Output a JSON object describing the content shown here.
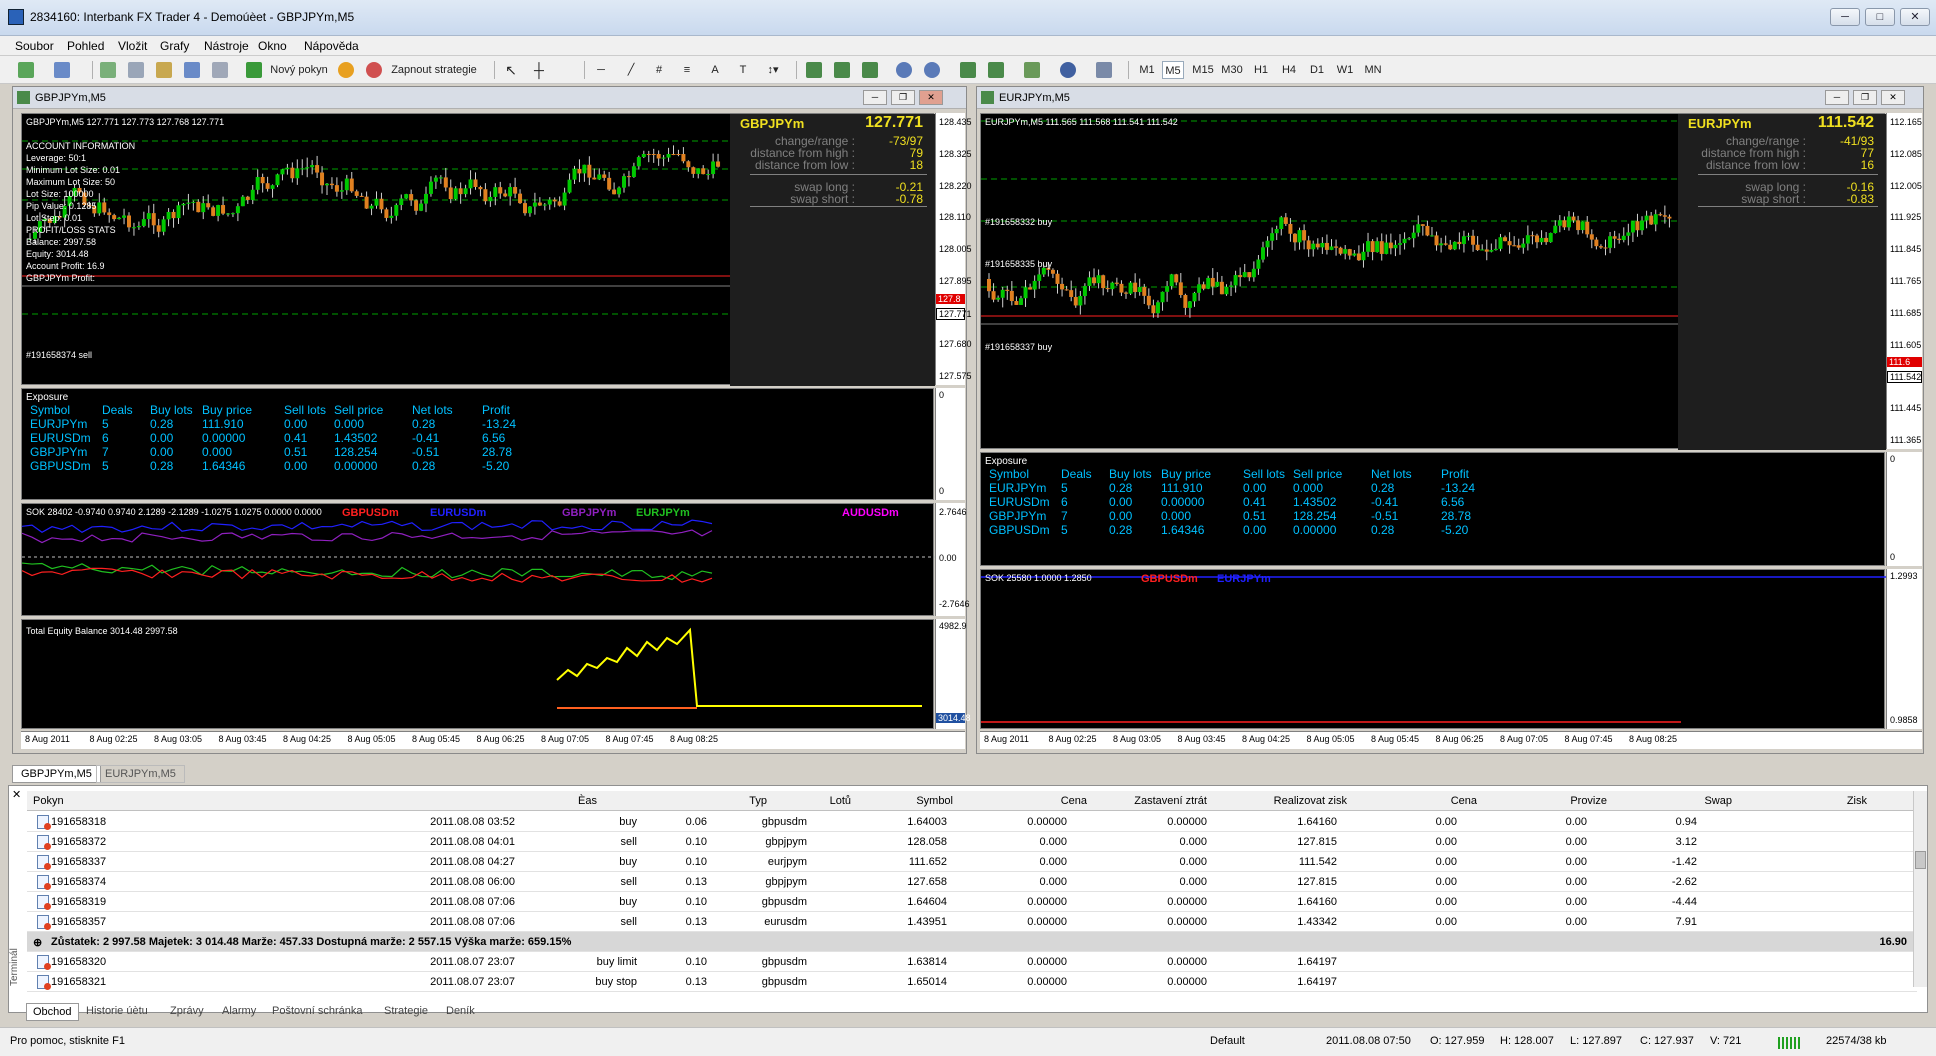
{
  "window": {
    "title": "2834160: Interbank FX Trader 4 - Demoúèet - GBPJPYm,M5"
  },
  "menu": [
    "Soubor",
    "Pohled",
    "Vložit",
    "Grafy",
    "Nástroje",
    "Okno",
    "Nápověda"
  ],
  "toolbar": {
    "new_order": "Nový pokyn",
    "expert": "Zapnout strategie",
    "timeframes": [
      "M1",
      "M5",
      "M15",
      "M30",
      "H1",
      "H4",
      "D1",
      "W1",
      "MN"
    ]
  },
  "chart1": {
    "title": "GBPJPYm,M5",
    "ohlc": "GBPJPYm,M5  127.771 127.773 127.768 127.771",
    "info_lines": [
      "ACCOUNT INFORMATION",
      "Leverage: 50:1",
      "Minimum Lot Size: 0.01",
      "Maximum Lot Size: 50",
      "Lot Size: 100000",
      "Pip Value: 0.1285",
      "Lot Step: 0.01",
      "PROFIT/LOSS STATS",
      "Balance: 2997.58",
      "Equity: 3014.48",
      "Account Profit: 16.9",
      "GBPJPYm Profit:"
    ],
    "order_label": "#191658374 sell",
    "panel": {
      "symbol": "GBPJPYm",
      "price": "127.771",
      "rows": [
        [
          "change/range :",
          "-73/97"
        ],
        [
          "distance from high :",
          "79"
        ],
        [
          "distance from low :",
          "18"
        ],
        [
          "swap long :",
          "-0.21"
        ],
        [
          "swap short :",
          "-0.78"
        ]
      ]
    },
    "scale": [
      "128.435",
      "128.325",
      "128.220",
      "128.110",
      "128.005",
      "127.895",
      "127.771",
      "127.680",
      "127.575"
    ],
    "price_tag": "127.771",
    "red_tag": "127.8",
    "exposure_scale": [
      "0",
      "0"
    ],
    "sok_label": "SOK 28402 -0.9740 0.9740 2.1289 -2.1289 -1.0275 1.0275 0.0000 0.0000",
    "sok_legends": [
      {
        "name": "GBPUSDm",
        "color": "#ff2020"
      },
      {
        "name": "EURUSDm",
        "color": "#2020ff"
      },
      {
        "name": "GBPJPYm",
        "color": "#9020c0"
      },
      {
        "name": "EURJPYm",
        "color": "#20c020"
      },
      {
        "name": "AUDUSDm",
        "color": "#ff00ff"
      }
    ],
    "sok_scale": [
      "2.7646",
      "0.00",
      "-2.7646"
    ],
    "eq_label": "Total Equity Balance 3014.48 2997.58",
    "eq_scale": [
      "4982.9",
      "3014.48"
    ],
    "xaxis": [
      "8 Aug 2011",
      "8 Aug 02:25",
      "8 Aug 03:05",
      "8 Aug 03:45",
      "8 Aug 04:25",
      "8 Aug 05:05",
      "8 Aug 05:45",
      "8 Aug 06:25",
      "8 Aug 07:05",
      "8 Aug 07:45",
      "8 Aug 08:25"
    ]
  },
  "chart2": {
    "title": "EURJPYm,M5",
    "ohlc": "EURJPYm,M5  111.565 111.568 111.541 111.542",
    "order_labels": [
      "#191658332 buy",
      "#191658335 buy",
      "#191658337 buy"
    ],
    "panel": {
      "symbol": "EURJPYm",
      "price": "111.542",
      "rows": [
        [
          "change/range :",
          "-41/93"
        ],
        [
          "distance from high :",
          "77"
        ],
        [
          "distance from low :",
          "16"
        ],
        [
          "swap long :",
          "-0.16"
        ],
        [
          "swap short :",
          "-0.83"
        ]
      ]
    },
    "scale": [
      "112.165",
      "112.085",
      "112.005",
      "111.925",
      "111.845",
      "111.765",
      "111.685",
      "111.605",
      "111.542",
      "111.445",
      "111.365"
    ],
    "price_tag": "111.542",
    "red_tag": "111.6",
    "sok_label": "SOK 25580 1.0000 1.2850",
    "sok_legends": [
      {
        "name": "GBPUSDm",
        "color": "#ff2020"
      },
      {
        "name": "EURJPYm",
        "color": "#2020ff"
      }
    ],
    "sok_scale": [
      "1.2993",
      "0.9858"
    ],
    "xaxis": [
      "8 Aug 2011",
      "8 Aug 02:25",
      "8 Aug 03:05",
      "8 Aug 03:45",
      "8 Aug 04:25",
      "8 Aug 05:05",
      "8 Aug 05:45",
      "8 Aug 06:25",
      "8 Aug 07:05",
      "8 Aug 07:45",
      "8 Aug 08:25"
    ]
  },
  "exposure": {
    "title": "Exposure",
    "headers": [
      "Symbol",
      "Deals",
      "Buy lots",
      "Buy price",
      "Sell lots",
      "Sell price",
      "Net lots",
      "Profit"
    ],
    "rows": [
      [
        "EURJPYm",
        "5",
        "0.28",
        "111.910",
        "0.00",
        "0.000",
        "0.28",
        "-13.24"
      ],
      [
        "EURUSDm",
        "6",
        "0.00",
        "0.00000",
        "0.41",
        "1.43502",
        "-0.41",
        "6.56"
      ],
      [
        "GBPJPYm",
        "7",
        "0.00",
        "0.000",
        "0.51",
        "128.254",
        "-0.51",
        "28.78"
      ],
      [
        "GBPUSDm",
        "5",
        "0.28",
        "1.64346",
        "0.00",
        "0.00000",
        "0.28",
        "-5.20"
      ]
    ]
  },
  "chart_tabs": [
    "GBPJPYm,M5",
    "EURJPYm,M5"
  ],
  "terminal": {
    "headers": [
      "Pokyn",
      "Èas",
      "Typ",
      "Lotů",
      "Symbol",
      "Cena",
      "Zastavení ztrát",
      "Realizovat zisk",
      "Cena",
      "Provize",
      "Swap",
      "Zisk"
    ],
    "rows": [
      [
        "191658318",
        "2011.08.08 03:52",
        "buy",
        "0.06",
        "gbpusdm",
        "1.64003",
        "0.00000",
        "0.00000",
        "1.64160",
        "0.00",
        "0.00",
        "0.94"
      ],
      [
        "191658372",
        "2011.08.08 04:01",
        "sell",
        "0.10",
        "gbpjpym",
        "128.058",
        "0.000",
        "0.000",
        "127.815",
        "0.00",
        "0.00",
        "3.12"
      ],
      [
        "191658337",
        "2011.08.08 04:27",
        "buy",
        "0.10",
        "eurjpym",
        "111.652",
        "0.000",
        "0.000",
        "111.542",
        "0.00",
        "0.00",
        "-1.42"
      ],
      [
        "191658374",
        "2011.08.08 06:00",
        "sell",
        "0.13",
        "gbpjpym",
        "127.658",
        "0.000",
        "0.000",
        "127.815",
        "0.00",
        "0.00",
        "-2.62"
      ],
      [
        "191658319",
        "2011.08.08 07:06",
        "buy",
        "0.10",
        "gbpusdm",
        "1.64604",
        "0.00000",
        "0.00000",
        "1.64160",
        "0.00",
        "0.00",
        "-4.44"
      ],
      [
        "191658357",
        "2011.08.08 07:06",
        "sell",
        "0.13",
        "eurusdm",
        "1.43951",
        "0.00000",
        "0.00000",
        "1.43342",
        "0.00",
        "0.00",
        "7.91"
      ]
    ],
    "summary": "Zůstatek: 2 997.58  Majetek: 3 014.48  Marže: 457.33  Dostupná marže: 2 557.15  Výška marže: 659.15%",
    "summary_total": "16.90",
    "pending": [
      [
        "191658320",
        "2011.08.07 23:07",
        "buy limit",
        "0.10",
        "gbpusdm",
        "1.63814",
        "0.00000",
        "0.00000",
        "1.64197"
      ],
      [
        "191658321",
        "2011.08.07 23:07",
        "buy stop",
        "0.13",
        "gbpusdm",
        "1.65014",
        "0.00000",
        "0.00000",
        "1.64197"
      ]
    ],
    "tabs": [
      "Obchod",
      "Historie úètu",
      "Zprávy",
      "Alarmy",
      "Poštovní schránka",
      "Strategie",
      "Deník"
    ],
    "side_label": "Terminál"
  },
  "status": {
    "help": "Pro pomoc, stisknite F1",
    "profile": "Default",
    "time": "2011.08.08 07:50",
    "o": "O: 127.959",
    "h": "H: 128.007",
    "l": "L: 127.897",
    "c": "C: 127.937",
    "v": "V: 721",
    "traffic": "22574/38 kb"
  },
  "colors": {
    "bull": "#00c800",
    "bear": "#e08020",
    "dashed": "#00a000",
    "grid": "#1a1a1a",
    "panel_yellow": "#f0e020",
    "panel_gray": "#808080",
    "expo": "#00c0ff",
    "eq": "#ffff00"
  }
}
